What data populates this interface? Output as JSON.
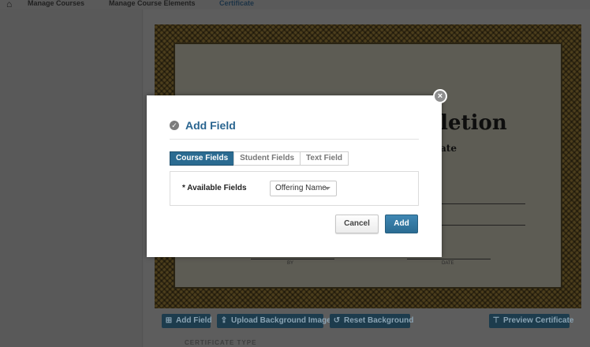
{
  "nav": {
    "home_icon": "home-icon",
    "items": [
      "Manage Courses",
      "Manage Course Elements",
      "Certificate"
    ]
  },
  "certificate": {
    "title_partial": "pletion",
    "subtitle_partial": "ate",
    "caption_left": "BY",
    "caption_right": "DATE"
  },
  "toolbar": {
    "add_field": "Add Field",
    "upload_background": "Upload Background Image",
    "reset_background": "Reset Background",
    "preview": "Preview Certificate"
  },
  "section": {
    "certificate_type": "CERTIFICATE TYPE"
  },
  "modal": {
    "title": "Add Field",
    "tabs": [
      {
        "label": "Course Fields",
        "active": true
      },
      {
        "label": "Student Fields",
        "active": false
      },
      {
        "label": "Text Field",
        "active": false
      }
    ],
    "available_fields_label": "* Available Fields",
    "available_fields_value": "Offering Name",
    "cancel_label": "Cancel",
    "add_label": "Add",
    "close_symbol": "×"
  },
  "colors": {
    "accent": "#2b6b91",
    "overlay": "#5b5b5b"
  }
}
